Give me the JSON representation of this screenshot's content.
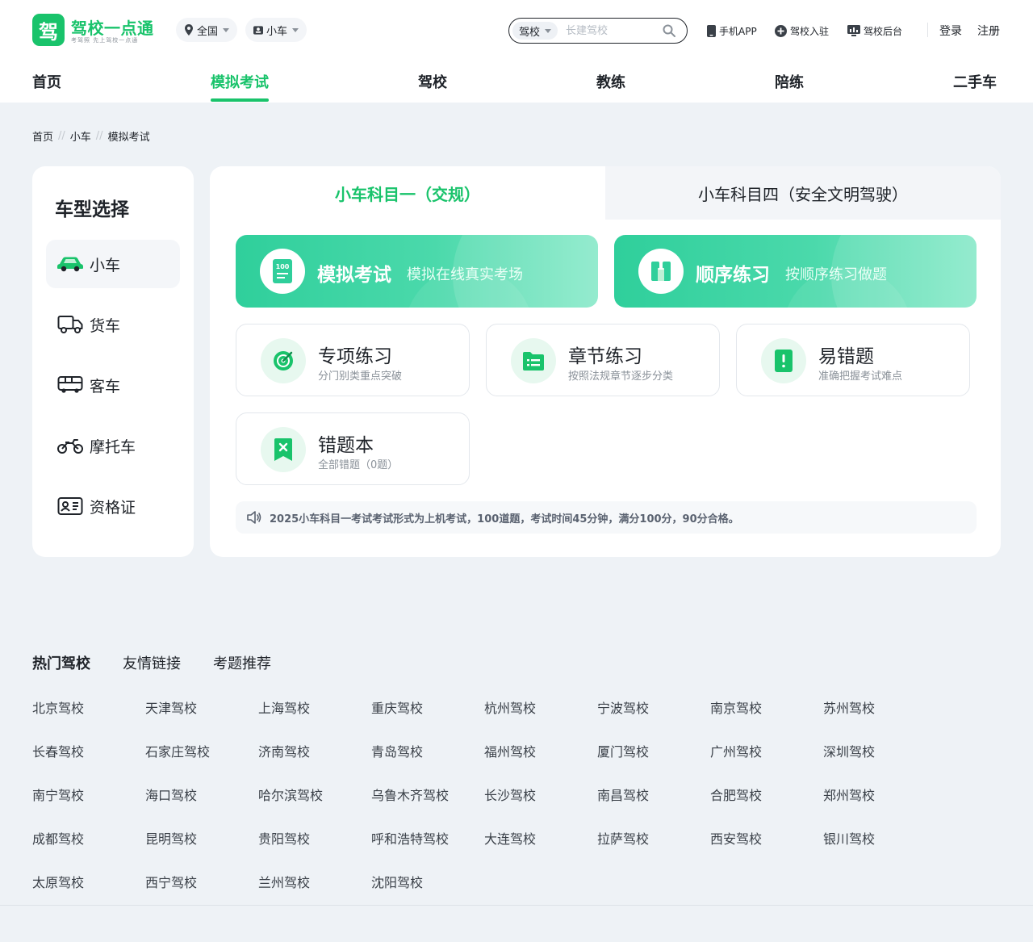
{
  "brand": {
    "logo_glyph": "驾",
    "name": "驾校一点通",
    "slogan": "考驾照 先上驾校一点通",
    "accent_color": "#19c36b"
  },
  "header": {
    "region": "全国",
    "vehicle": "小车",
    "search": {
      "type": "驾校",
      "placeholder": "长建驾校"
    },
    "links": {
      "app": "手机APP",
      "join": "驾校入驻",
      "backend": "驾校后台"
    },
    "login": "登录",
    "register": "注册"
  },
  "nav": [
    "首页",
    "模拟考试",
    "驾校",
    "教练",
    "陪练",
    "二手车"
  ],
  "breadcrumb": [
    "首页",
    "小车",
    "模拟考试"
  ],
  "sidebar": {
    "title": "车型选择",
    "items": [
      {
        "label": "小车",
        "icon": "car-icon"
      },
      {
        "label": "货车",
        "icon": "truck-icon"
      },
      {
        "label": "客车",
        "icon": "bus-icon"
      },
      {
        "label": "摩托车",
        "icon": "motorcycle-icon"
      },
      {
        "label": "资格证",
        "icon": "certificate-icon"
      }
    ]
  },
  "tabs": [
    "小车科目一（交规）",
    "小车科目四（安全文明驾驶）"
  ],
  "primary_cards": [
    {
      "title": "模拟考试",
      "desc": "模拟在线真实考场",
      "icon_text": "100"
    },
    {
      "title": "顺序练习",
      "desc": "按顺序练习做题"
    }
  ],
  "practice_cards": [
    {
      "title": "专项练习",
      "desc": "分门别类重点突破"
    },
    {
      "title": "章节练习",
      "desc": "按照法规章节逐步分类"
    },
    {
      "title": "易错题",
      "desc": "准确把握考试难点"
    },
    {
      "title": "错题本",
      "desc": "全部错题（0题）"
    }
  ],
  "notice": "2025小车科目一考试考试形式为上机考试，100道题，考试时间45分钟，满分100分，90分合格。",
  "footer": {
    "tabs": [
      "热门驾校",
      "友情链接",
      "考题推荐"
    ],
    "schools": [
      "北京驾校",
      "天津驾校",
      "上海驾校",
      "重庆驾校",
      "杭州驾校",
      "宁波驾校",
      "南京驾校",
      "苏州驾校",
      "长春驾校",
      "石家庄驾校",
      "济南驾校",
      "青岛驾校",
      "福州驾校",
      "厦门驾校",
      "广州驾校",
      "深圳驾校",
      "南宁驾校",
      "海口驾校",
      "哈尔滨驾校",
      "乌鲁木齐驾校",
      "长沙驾校",
      "南昌驾校",
      "合肥驾校",
      "郑州驾校",
      "成都驾校",
      "昆明驾校",
      "贵阳驾校",
      "呼和浩特驾校",
      "大连驾校",
      "拉萨驾校",
      "西安驾校",
      "银川驾校",
      "太原驾校",
      "西宁驾校",
      "兰州驾校",
      "沈阳驾校"
    ]
  }
}
